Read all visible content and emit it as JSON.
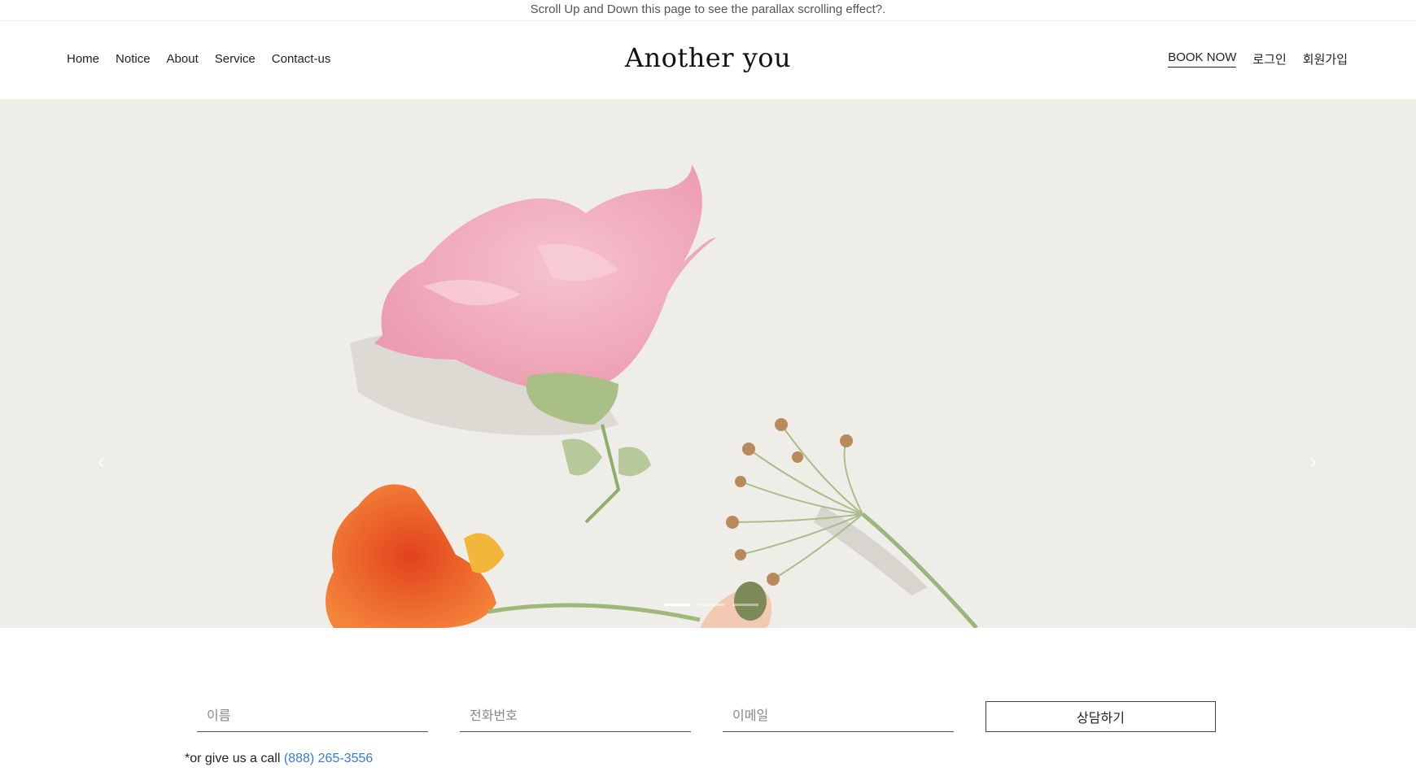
{
  "notice_bar": {
    "text": "Scroll Up and Down this page to see the parallax scrolling effect?."
  },
  "header": {
    "logo": "Another you",
    "nav_left": [
      "Home",
      "Notice",
      "About",
      "Service",
      "Contact-us"
    ],
    "nav_right": {
      "book_now": "BOOK NOW",
      "login": "로그인",
      "signup": "회원가입"
    }
  },
  "hero": {
    "prev_icon": "chevron-left-icon",
    "next_icon": "chevron-right-icon",
    "prev_glyph": "‹",
    "next_glyph": "›",
    "background_color": "#efede8"
  },
  "contact": {
    "name_placeholder": "이름",
    "phone_placeholder": "전화번호",
    "email_placeholder": "이메일",
    "submit_label": "상담하기",
    "call_prefix": "*or give us a call",
    "phone": "(888) 265-3556",
    "link_color": "#3a7bc8"
  }
}
